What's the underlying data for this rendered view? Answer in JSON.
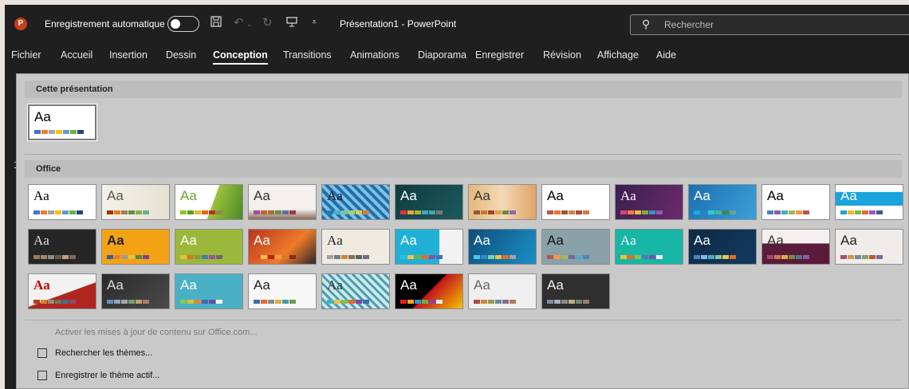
{
  "titlebar": {
    "app_icon_letter": "P",
    "autosave_label": "Enregistrement automatique",
    "autosave_state": "off",
    "doc_title": "Présentation1 - PowerPoint",
    "search_placeholder": "Rechercher",
    "quick_access_icons": [
      "save-icon",
      "undo-icon",
      "redo-icon",
      "present-icon",
      "customize-icon"
    ]
  },
  "tabs": [
    "Fichier",
    "Accueil",
    "Insertion",
    "Dessin",
    "Conception",
    "Transitions",
    "Animations",
    "Diaporama",
    "Enregistrer",
    "Révision",
    "Affichage",
    "Aide"
  ],
  "active_tab": "Conception",
  "slide_number": "1",
  "gallery": {
    "section_current": "Cette présentation",
    "section_office": "Office",
    "theme_sample": "Aa",
    "current_theme": {
      "sample": "Aa",
      "bg": "#ffffff",
      "fg": "#000000",
      "swatches": [
        "#4472c4",
        "#ed7d31",
        "#a5a5a5",
        "#ffc000",
        "#5b9bd5",
        "#70ad47",
        "#264478"
      ]
    }
  },
  "footer": {
    "activate_label": "Activer les mises à jour de contenu sur Office.com...",
    "browse_label": "Rechercher les thèmes...",
    "save_label": "Enregistrer le thème actif..."
  },
  "colors": {
    "titlebar_bg": "#1f1f1f",
    "gallery_bg": "#c9c9c9",
    "accent": "#c43e1c"
  }
}
